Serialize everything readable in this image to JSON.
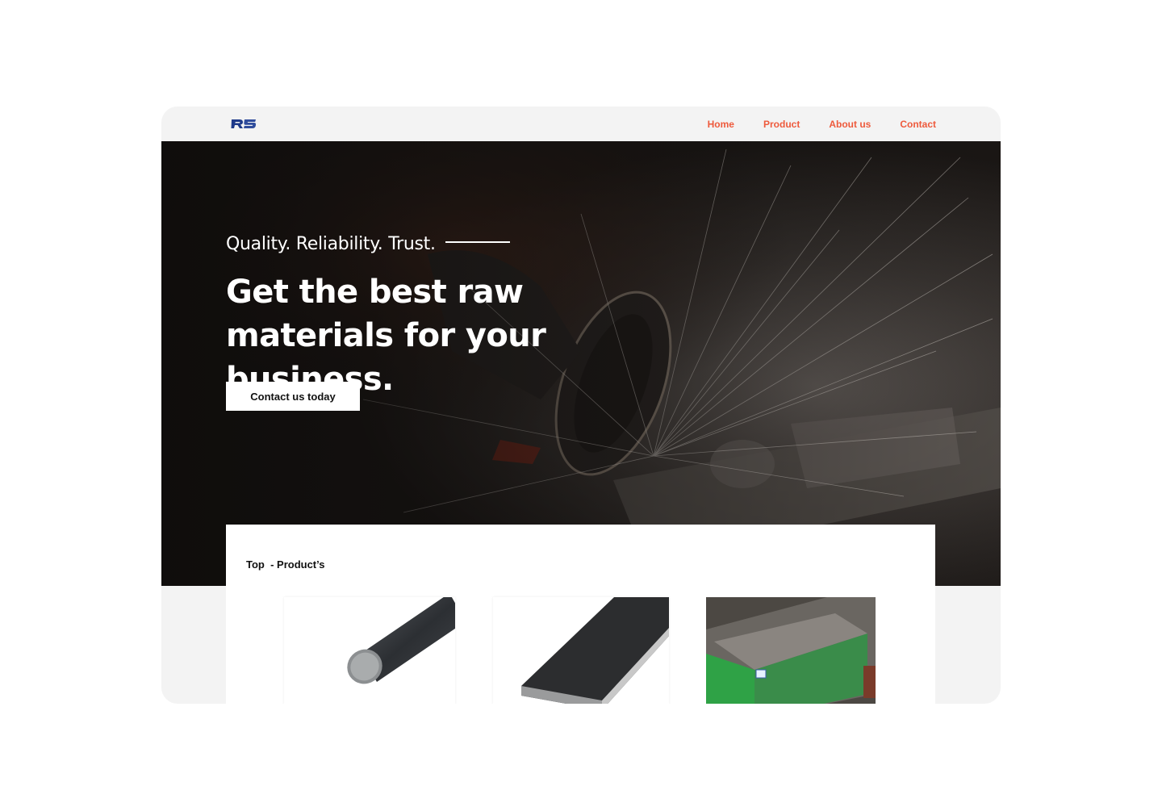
{
  "logo": {
    "text": "RS",
    "colors": [
      "#1e3a8a",
      "#2f4c9c"
    ]
  },
  "nav": {
    "links": [
      {
        "label": "Home"
      },
      {
        "label": "Product"
      },
      {
        "label": "About us"
      },
      {
        "label": "Contact"
      }
    ],
    "link_color": "#ee5a3c"
  },
  "hero": {
    "tagline": "Quality. Reliability. Trust.",
    "headline": "Get the best raw materials for your business.",
    "cta_label": "Contact us  today"
  },
  "products": {
    "title": "Top  - Product’s",
    "items": [
      {
        "image": "round-steel-bar"
      },
      {
        "image": "flat-steel-bar"
      },
      {
        "image": "steel-block-on-pallet"
      }
    ]
  }
}
